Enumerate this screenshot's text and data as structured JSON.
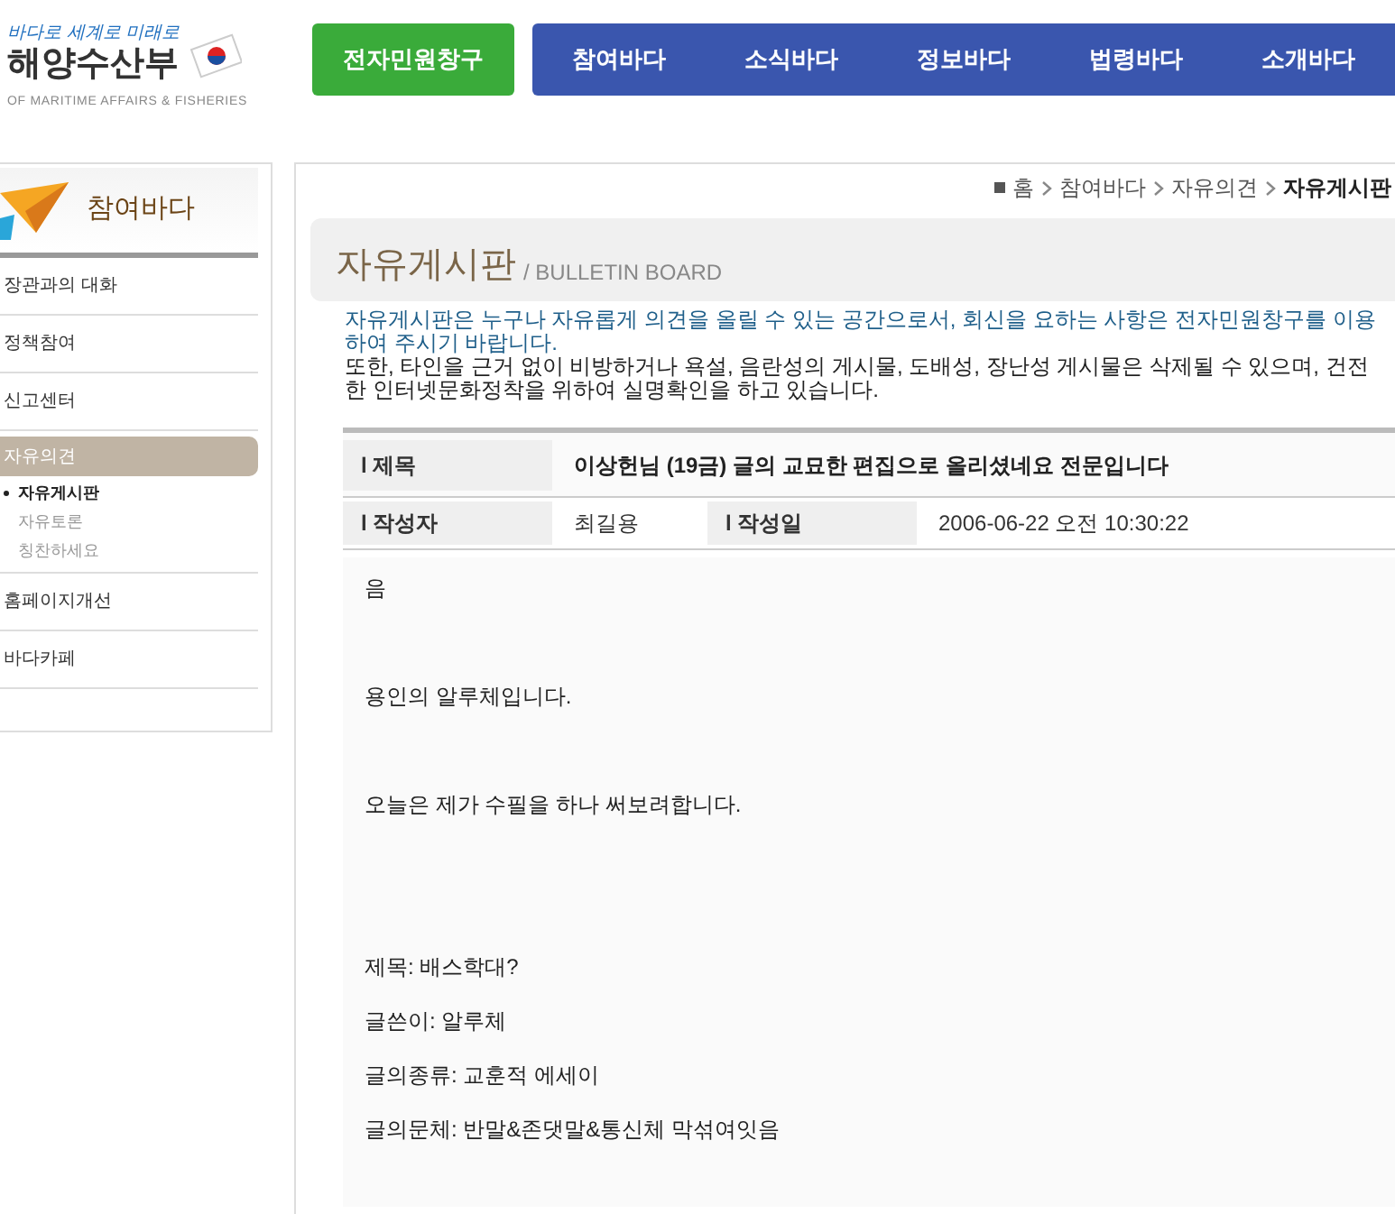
{
  "header": {
    "logo": {
      "slogan": "바다로 세계로 미래로",
      "name": "해양수산부",
      "subtitle": "OF MARITIME AFFAIRS & FISHERIES"
    },
    "civil_button": "전자민원창구",
    "nav": [
      "참여바다",
      "소식바다",
      "정보바다",
      "법령바다",
      "소개바다"
    ]
  },
  "sidebar": {
    "title": "참여바다",
    "items": [
      {
        "label": "장관과의 대화",
        "selected": false
      },
      {
        "label": "정책참여",
        "selected": false
      },
      {
        "label": "신고센터",
        "selected": false
      },
      {
        "label": "자유의견",
        "selected": true,
        "children": [
          {
            "label": "자유게시판",
            "selected": true
          },
          {
            "label": "자유토론",
            "selected": false
          },
          {
            "label": "칭찬하세요",
            "selected": false
          }
        ]
      },
      {
        "label": "홈페이지개선",
        "selected": false
      },
      {
        "label": "바다카페",
        "selected": false
      }
    ]
  },
  "breadcrumb": [
    "홈",
    "참여바다",
    "자유의견",
    "자유게시판"
  ],
  "page_title": {
    "main": "자유게시판",
    "sub": "/ BULLETIN BOARD"
  },
  "notice": [
    "자유게시판은 누구나 자유롭게 의견을 올릴 수 있는 공간으로서, 회신을 요하는 사항은 전자민원창구를 이용하여 주시기 바랍니다.",
    "또한, 타인을 근거 없이 비방하거나 욕설, 음란성의 게시물, 도배성, 장난성 게시물은 삭제될 수 있으며, 건전한 인터넷문화정착을 위하여 실명확인을 하고 있습니다."
  ],
  "post": {
    "subject_label": "l 제목",
    "subject": "이상헌님 (19금) 글의 교묘한 편집으로 올리셨네요 전문입니다",
    "author_label": "l 작성자",
    "author": "최길용",
    "date_label": "l 작성일",
    "date": "2006-06-22 오전 10:30:22",
    "body": [
      {
        "kind": "paragraph",
        "lines": [
          "음"
        ]
      },
      {
        "kind": "paragraph",
        "lines": [
          "용인의 알루체입니다."
        ]
      },
      {
        "kind": "paragraph",
        "lines": [
          "오늘은 제가 수필을 하나 써보려합니다."
        ]
      },
      {
        "kind": "info_block",
        "lines": [
          "제목: 배스학대?",
          "글쓴이: 알루체",
          "글의종류: 교훈적 에세이",
          "글의문체: 반말&존댓말&통신체 막섞여잇음"
        ]
      }
    ]
  }
}
